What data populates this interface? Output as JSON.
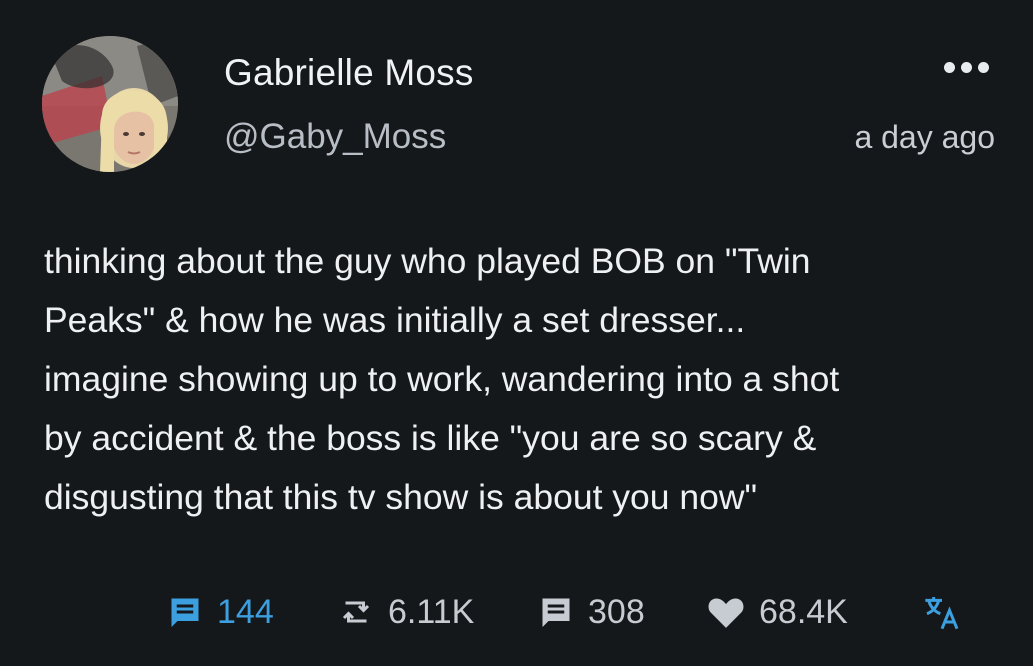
{
  "user": {
    "display_name": "Gabrielle Moss",
    "handle": "@Gaby_Moss",
    "avatar_icon": "profile-photo"
  },
  "timestamp": "a day ago",
  "more_icon": "more-horizontal-icon",
  "tweet": {
    "lines": [
      "thinking about the guy who played BOB on \"Twin",
      "Peaks\" & how he was initially a set dresser...",
      "imagine showing up to work, wandering into a shot",
      "by accident & the boss is like \"you are so scary &",
      "disgusting that this tv show is about you now\""
    ]
  },
  "actions": {
    "replies": "144",
    "retweets": "6.11K",
    "quotes": "308",
    "likes": "68.4K"
  },
  "colors": {
    "background": "#15181b",
    "accent": "#3c9fdf",
    "muted_icon": "#c6ccd2"
  }
}
